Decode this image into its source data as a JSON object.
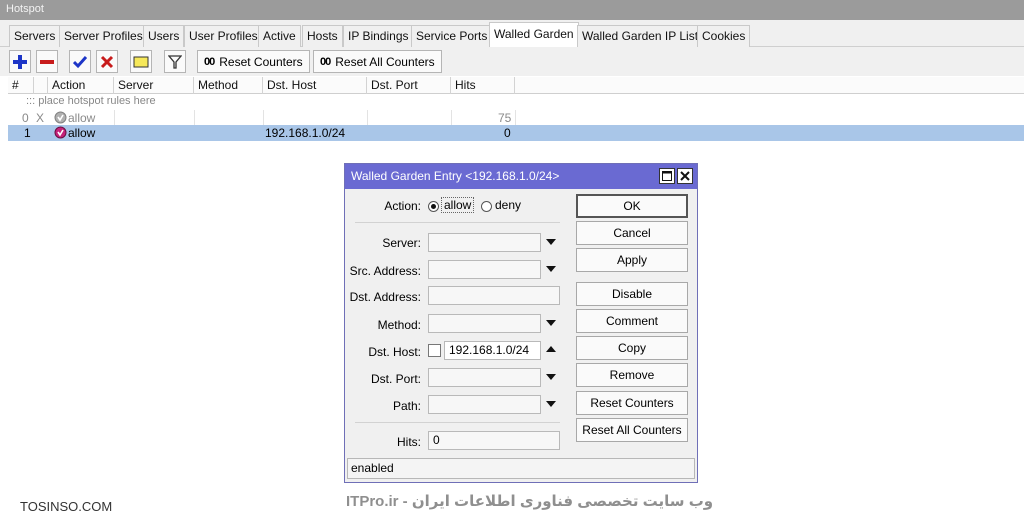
{
  "window": {
    "title": "Hotspot"
  },
  "tabs": [
    {
      "label": "Servers"
    },
    {
      "label": "Server Profiles"
    },
    {
      "label": "Users"
    },
    {
      "label": "User Profiles"
    },
    {
      "label": "Active"
    },
    {
      "label": "Hosts"
    },
    {
      "label": "IP Bindings"
    },
    {
      "label": "Service Ports"
    },
    {
      "label": "Walled Garden"
    },
    {
      "label": "Walled Garden IP List"
    },
    {
      "label": "Cookies"
    }
  ],
  "toolbar": {
    "reset_counters": "Reset Counters",
    "reset_all_counters": "Reset All Counters",
    "counter_glyph": "00",
    "icons": [
      "add-icon",
      "remove-icon",
      "enable-check-icon",
      "disable-x-icon",
      "comment-icon",
      "filter-icon"
    ]
  },
  "table": {
    "columns": [
      "#",
      "Action",
      "Server",
      "Method",
      "Dst. Host",
      "Dst. Port",
      "Hits"
    ],
    "placeholder": "::: place hotspot rules here",
    "rows": [
      {
        "num": "0",
        "flag": "X",
        "action": "allow",
        "server": "",
        "method": "",
        "dst_host": "",
        "dst_port": "",
        "hits": "75"
      },
      {
        "num": "1",
        "flag": "",
        "action": "allow",
        "server": "",
        "method": "",
        "dst_host": "192.168.1.0/24",
        "dst_port": "",
        "hits": "0"
      }
    ]
  },
  "dialog": {
    "title": "Walled Garden Entry <192.168.1.0/24>",
    "action_label": "Action:",
    "action_options": [
      "allow",
      "deny"
    ],
    "action_selected": "allow",
    "fields": {
      "server": {
        "label": "Server:",
        "value": ""
      },
      "src_address": {
        "label": "Src. Address:",
        "value": ""
      },
      "dst_address": {
        "label": "Dst. Address:",
        "value": ""
      },
      "method": {
        "label": "Method:",
        "value": ""
      },
      "dst_host": {
        "label": "Dst. Host:",
        "value": "192.168.1.0/24"
      },
      "dst_port": {
        "label": "Dst. Port:",
        "value": ""
      },
      "path": {
        "label": "Path:",
        "value": ""
      },
      "hits": {
        "label": "Hits:",
        "value": "0"
      }
    },
    "buttons": {
      "ok": "OK",
      "cancel": "Cancel",
      "apply": "Apply",
      "disable": "Disable",
      "comment": "Comment",
      "copy": "Copy",
      "remove": "Remove",
      "reset_counters": "Reset Counters",
      "reset_all_counters": "Reset All Counters"
    },
    "status": "enabled"
  },
  "watermarks": {
    "left": "TOSINSO.COM",
    "center": "ITPro.ir - وب سایت تخصصی فناوری اطلاعات ایران"
  },
  "colors": {
    "titlebar": "#9b9b9b",
    "dialog_title": "#6a6ad2",
    "selected_row": "#a9c6e8",
    "add_icon": "#1d35c7",
    "remove_icon": "#c81c1c"
  }
}
